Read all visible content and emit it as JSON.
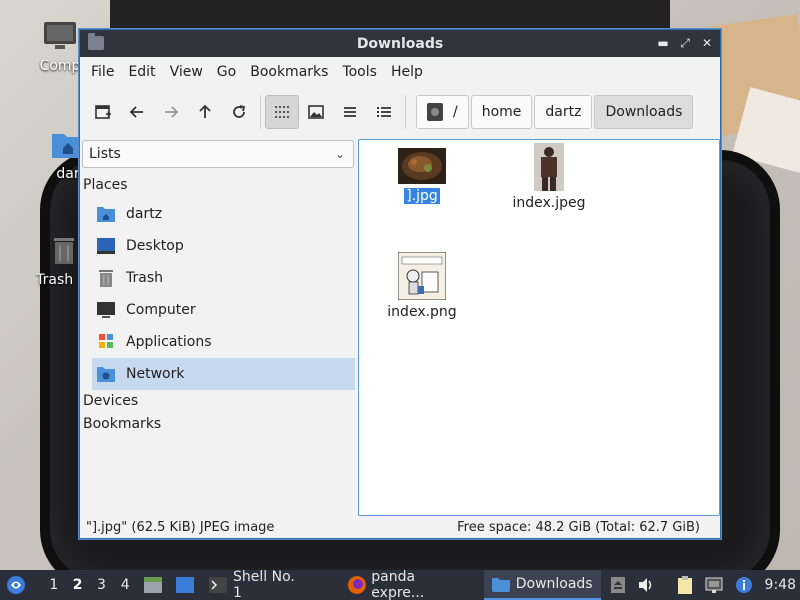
{
  "desktop": {
    "icons": [
      {
        "label": "Comp",
        "icon": "computer-icon"
      },
      {
        "label": "dar",
        "icon": "home-folder-icon"
      },
      {
        "label": "Trash (E",
        "icon": "trash-icon"
      }
    ]
  },
  "window": {
    "title": "Downloads",
    "controls": {
      "minimize": "▬",
      "maximize": "⤢",
      "close": "✕"
    }
  },
  "menu": [
    "File",
    "Edit",
    "View",
    "Go",
    "Bookmarks",
    "Tools",
    "Help"
  ],
  "toolbar": {
    "buttons": [
      "new-tab-icon",
      "back-arrow-icon",
      "forward-arrow-icon",
      "up-arrow-icon",
      "reload-icon",
      "icon-view-icon",
      "thumbnail-view-icon",
      "compact-view-icon",
      "detailed-list-view-icon"
    ],
    "path": [
      "/",
      "home",
      "dartz",
      "Downloads"
    ]
  },
  "sidebar": {
    "combo_value": "Lists",
    "places_header": "Places",
    "places": [
      {
        "label": "dartz",
        "icon": "home-folder-icon",
        "color": "#4a90d9"
      },
      {
        "label": "Desktop",
        "icon": "desktop-icon",
        "color": "#3a7bd5"
      },
      {
        "label": "Trash",
        "icon": "trash-icon",
        "color": "#888888"
      },
      {
        "label": "Computer",
        "icon": "computer-icon",
        "color": "#333333"
      },
      {
        "label": "Applications",
        "icon": "applications-icon",
        "color": "#e9533c"
      },
      {
        "label": "Network",
        "icon": "network-folder-icon",
        "color": "#4a90d9"
      }
    ],
    "devices_header": "Devices",
    "bookmarks_header": "Bookmarks"
  },
  "files": [
    {
      "name": "].jpg",
      "selected": true
    },
    {
      "name": "index.jpeg",
      "selected": false
    },
    {
      "name": "index.png",
      "selected": false
    }
  ],
  "status": {
    "left": "\"].jpg\" (62.5 KiB) JPEG image",
    "right": "Free space: 48.2 GiB (Total: 62.7 GiB)"
  },
  "taskbar": {
    "workspaces": [
      "1",
      "2",
      "3",
      "4"
    ],
    "current_workspace": "2",
    "tasks": [
      {
        "label": "Shell No. 1",
        "icon": "terminal-icon"
      },
      {
        "label": "panda expre...",
        "icon": "firefox-icon"
      },
      {
        "label": "Downloads",
        "icon": "folder-icon"
      }
    ],
    "clock": "9:48"
  },
  "colors": {
    "accent": "#3584e4",
    "titlebar": "#2f343f",
    "taskbar": "#2b2f3a"
  }
}
